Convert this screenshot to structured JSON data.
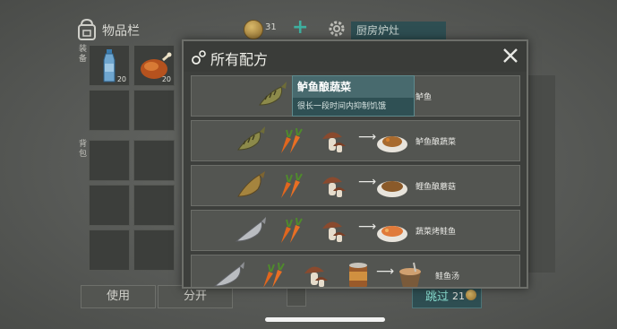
{
  "inventory": {
    "title": "物品栏",
    "coins": "31",
    "location": "厨房炉灶",
    "side_label_top": "装备",
    "side_label_mid": "背包",
    "slots": [
      {
        "item": "water-bottle",
        "count": "20"
      },
      {
        "item": "roasted-chicken",
        "count": "20"
      }
    ],
    "use_label": "使用",
    "split_label": "分开",
    "skip_label": "跳过",
    "skip_cost": "21"
  },
  "modal": {
    "title": "所有配方"
  },
  "tooltip": {
    "title": "鲈鱼酿蔬菜",
    "description": "很长一段时间内抑制饥饿"
  },
  "recipes": [
    {
      "ingredients": [
        "perch-fish"
      ],
      "result_name": "鲈鱼"
    },
    {
      "ingredients": [
        "perch-fish",
        "carrot",
        "mushroom"
      ],
      "result_name": "鲈鱼酿蔬菜"
    },
    {
      "ingredients": [
        "carp-fish",
        "carrot",
        "mushroom"
      ],
      "result_name": "鲤鱼酿蘑菇"
    },
    {
      "ingredients": [
        "salmon-fish",
        "carrot",
        "mushroom"
      ],
      "result_name": "蔬菜烤鲑鱼"
    },
    {
      "ingredients": [
        "salmon-fish",
        "carrot",
        "mushroom",
        "can"
      ],
      "result_name": "鲑鱼汤"
    }
  ],
  "colors": {
    "accent_teal": "#2e4e52",
    "tooltip_bg": "#486a6e",
    "modal_bg": "#3d3f3c"
  }
}
